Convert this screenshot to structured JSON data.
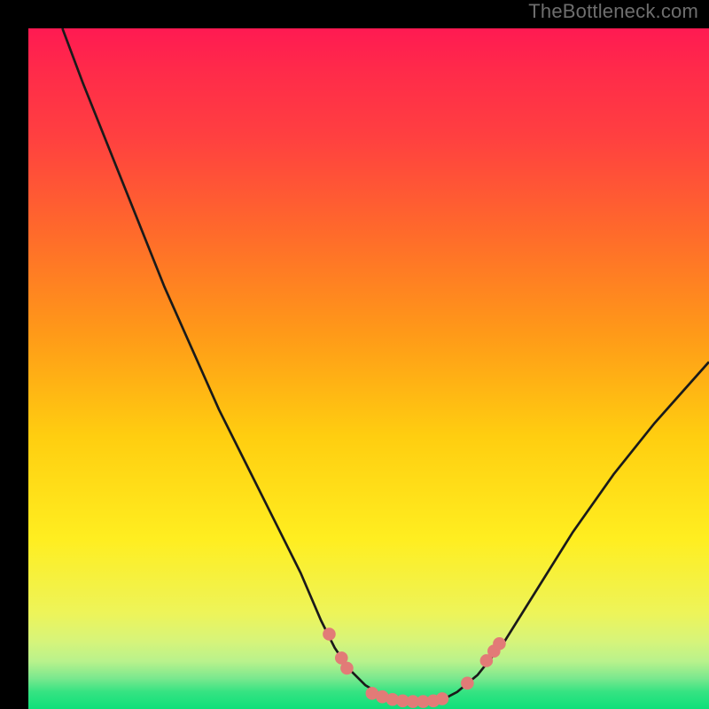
{
  "watermark": "TheBottleneck.com",
  "colors": {
    "background": "#000000",
    "curve_stroke": "#1a1a1a",
    "marker_fill": "#e27b77",
    "gradient_top": "#ff1a52",
    "gradient_mid": "#ffee20",
    "gradient_bottom": "#0ee07a"
  },
  "chart_data": {
    "type": "line",
    "title": "",
    "xlabel": "",
    "ylabel": "",
    "xlim": [
      0,
      100
    ],
    "ylim": [
      0,
      100
    ],
    "grid": false,
    "series": [
      {
        "name": "bottleneck-curve",
        "x": [
          5,
          8,
          12,
          16,
          20,
          24,
          28,
          32,
          36,
          40,
          43,
          45,
          47,
          49.5,
          52,
          55,
          58,
          60.5,
          63,
          66,
          70,
          75,
          80,
          86,
          92,
          100
        ],
        "y": [
          100,
          92,
          82,
          72,
          62,
          53,
          44,
          36,
          28,
          20,
          13,
          9,
          6,
          3.5,
          2,
          1.2,
          1,
          1.2,
          2.5,
          5,
          10,
          18,
          26,
          34.5,
          42,
          51
        ]
      }
    ],
    "markers": [
      {
        "name": "left-upper-dot",
        "x": 44.2,
        "y": 11.0
      },
      {
        "name": "left-mid-dot",
        "x": 46.0,
        "y": 7.5
      },
      {
        "name": "left-lower-dot",
        "x": 46.8,
        "y": 6.0
      },
      {
        "name": "baseline-dot-1",
        "x": 50.5,
        "y": 2.3
      },
      {
        "name": "baseline-dot-2",
        "x": 52.0,
        "y": 1.8
      },
      {
        "name": "baseline-dot-3",
        "x": 53.5,
        "y": 1.4
      },
      {
        "name": "baseline-dot-4",
        "x": 55.0,
        "y": 1.2
      },
      {
        "name": "baseline-dot-5",
        "x": 56.5,
        "y": 1.1
      },
      {
        "name": "baseline-dot-6",
        "x": 58.0,
        "y": 1.1
      },
      {
        "name": "baseline-dot-7",
        "x": 59.5,
        "y": 1.2
      },
      {
        "name": "baseline-dot-8",
        "x": 60.8,
        "y": 1.5
      },
      {
        "name": "right-lower-dot",
        "x": 64.5,
        "y": 3.8
      },
      {
        "name": "right-mid-dot",
        "x": 67.3,
        "y": 7.1
      },
      {
        "name": "right-upper-dot",
        "x": 68.4,
        "y": 8.5
      },
      {
        "name": "right-upper-dot-2",
        "x": 69.2,
        "y": 9.6
      }
    ]
  }
}
